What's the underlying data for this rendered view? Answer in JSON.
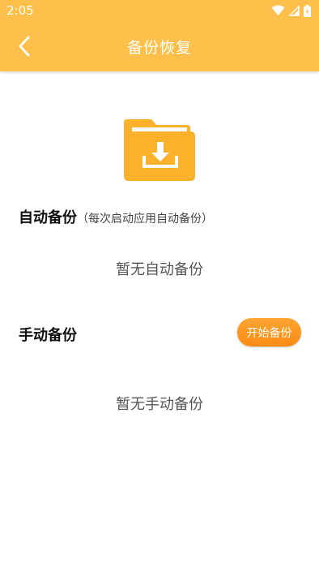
{
  "status_bar": {
    "time": "2:05",
    "icons": [
      "wifi-icon",
      "signal-icon",
      "battery-icon"
    ]
  },
  "header": {
    "title": "备份恢复",
    "back_icon": "chevron-left-icon"
  },
  "colors": {
    "primary": "#FEC04A",
    "folder": "#FBB22A",
    "button": "#FA8A12"
  },
  "auto_backup": {
    "title": "自动备份",
    "hint": "（每次启动应用自动备份）",
    "empty": "暂无自动备份"
  },
  "manual_backup": {
    "title": "手动备份",
    "button_label": "开始备份",
    "empty": "暂无手动备份"
  }
}
